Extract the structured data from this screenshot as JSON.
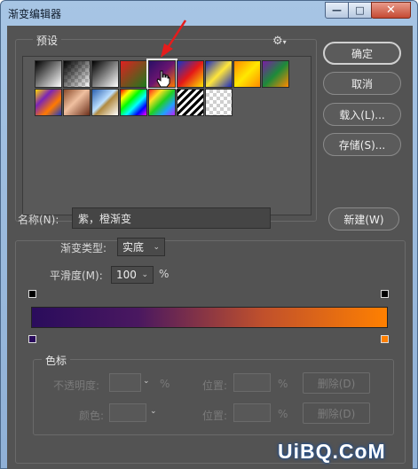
{
  "window": {
    "title": "渐变编辑器",
    "minimize_glyph": "—",
    "maximize_glyph": "□",
    "close_glyph": "✕"
  },
  "presets": {
    "label": "预设",
    "menu_icon": "gear-icon",
    "selected_index": 4,
    "swatches": [
      {
        "name": "foreground-to-background",
        "css": "linear-gradient(135deg,#000 0%,#fff 100%)"
      },
      {
        "name": "foreground-to-transparent",
        "css": "checker-black"
      },
      {
        "name": "black-white",
        "css": "linear-gradient(135deg,#000 0%,#fff 100%)"
      },
      {
        "name": "red-green",
        "css": "linear-gradient(135deg,#e02020 0%,#1c7a1c 100%)"
      },
      {
        "name": "violet-orange",
        "css": "linear-gradient(135deg,#2a0f66 0%,#6a1570 50%,#ff7a00 100%)"
      },
      {
        "name": "blue-red-yellow",
        "css": "linear-gradient(135deg,#1434c8 0%,#e41818 50%,#ffe400 100%)"
      },
      {
        "name": "blue-yellow-blue",
        "css": "linear-gradient(135deg,#1a2ac0 0%,#ffe63a 50%,#1a2ac0 100%)"
      },
      {
        "name": "orange-yellow-orange",
        "css": "linear-gradient(135deg,#ff8a00 0%,#ffe800 50%,#ff8a00 100%)"
      },
      {
        "name": "violet-green-orange",
        "css": "linear-gradient(135deg,#7a1ca6 0%,#1d8a3a 50%,#ff8a00 100%)"
      },
      {
        "name": "yellow-violet-orange-blue",
        "css": "linear-gradient(135deg,#ffd800 0%,#7b25b5 33%,#ff7a00 66%,#1a3ac8 100%)"
      },
      {
        "name": "copper",
        "css": "linear-gradient(135deg,#8a4a2a 0%,#f0c0a0 45%,#6a2e1a 100%)"
      },
      {
        "name": "chrome",
        "css": "linear-gradient(135deg,#2a60b0 0%,#bde0ff 45%,#b08a40 55%,#ffffff 100%)"
      },
      {
        "name": "spectrum",
        "css": "linear-gradient(135deg,#ff0000 0%,#ffff00 20%,#00ff00 40%,#00ffff 60%,#0000ff 80%,#ff00ff 100%)"
      },
      {
        "name": "transparent-rainbow",
        "css": "linear-gradient(135deg,#ff2020 0%,#ffe020 25%,#20d020 50%,#20a0ff 75%,#c020ff 100%)"
      },
      {
        "name": "transparent-stripes",
        "css": "stripes"
      },
      {
        "name": "transparent",
        "css": "checker"
      }
    ],
    "cursor_icon": "hand-cursor-icon",
    "annotation_icon": "red-arrow-icon"
  },
  "buttons": {
    "ok": "确定",
    "cancel": "取消",
    "load": "载入(L)...",
    "save": "存储(S)...",
    "new": "新建(W)"
  },
  "name_field": {
    "label": "名称(N):",
    "value": "紫，橙渐变"
  },
  "gradient": {
    "type_label": "渐变类型:",
    "type_value": "实底",
    "smooth_label": "平滑度(M):",
    "smooth_value": "100",
    "smooth_unit": "%",
    "colors": {
      "start": "#2a0c5c",
      "end": "#ff8000"
    }
  },
  "stops": {
    "label": "色标",
    "opacity_label": "不透明度:",
    "opacity_unit": "%",
    "position_label": "位置:",
    "position_unit": "%",
    "delete_label": "删除(D)",
    "color_label": "颜色:",
    "position2_label": "位置:",
    "position2_unit": "%",
    "delete2_label": "删除(D)"
  },
  "watermark": "UiBQ.CoM"
}
